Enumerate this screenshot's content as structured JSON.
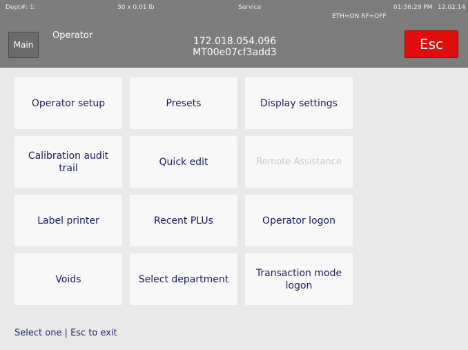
{
  "status": {
    "dept": "Dept#: 1:",
    "capacity": "30 x 0.01 lb",
    "mode": "Service",
    "time": "01:36:29 PM",
    "date": "12.02.14",
    "network": "ETH=ON  RF=OFF"
  },
  "header": {
    "main_label": "Main",
    "title": "Operator",
    "ip": "172.018.054.096",
    "mac": "MT00e07cf3add3",
    "esc_label": "Esc"
  },
  "menu": [
    {
      "label": "Operator setup",
      "enabled": true
    },
    {
      "label": "Presets",
      "enabled": true
    },
    {
      "label": "Display settings",
      "enabled": true
    },
    {
      "label": "Calibration audit trail",
      "enabled": true
    },
    {
      "label": "Quick edit",
      "enabled": true
    },
    {
      "label": "Remote Assistance",
      "enabled": false
    },
    {
      "label": "Label printer",
      "enabled": true
    },
    {
      "label": "Recent PLUs",
      "enabled": true
    },
    {
      "label": "Operator logon",
      "enabled": true
    },
    {
      "label": "Voids",
      "enabled": true
    },
    {
      "label": "Select department",
      "enabled": true
    },
    {
      "label": "Transaction mode logon",
      "enabled": true
    }
  ],
  "footer": {
    "hint": "Select one | Esc to exit"
  }
}
